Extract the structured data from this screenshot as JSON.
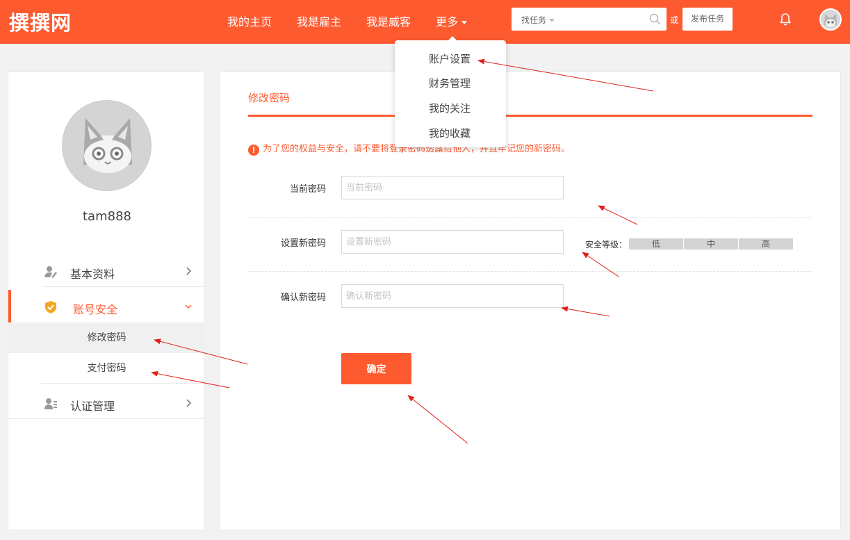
{
  "header": {
    "logo": "撰撰网",
    "nav": [
      "我的主页",
      "我是雇主",
      "我是威客"
    ],
    "more_label": "更多",
    "search": {
      "type_label": "找任务"
    },
    "or_text": "或",
    "publish_label": "发布任务"
  },
  "dropdown": {
    "items": [
      "账户设置",
      "财务管理",
      "我的关注",
      "我的收藏"
    ]
  },
  "sidebar": {
    "username": "tam888",
    "menu": {
      "basic": "基本资料",
      "security": "账号安全",
      "auth": "认证管理"
    },
    "submenu": {
      "change_password": "修改密码",
      "pay_password": "支付密码"
    }
  },
  "main": {
    "tab_title": "修改密码",
    "warning": "为了您的权益与安全，请不要将登录密码透露给他人，并且牢记您的新密码。",
    "fields": {
      "current_label": "当前密码",
      "current_placeholder": "当前密码",
      "new_label": "设置新密码",
      "new_placeholder": "设置新密码",
      "confirm_label": "确认新密码",
      "confirm_placeholder": "确认新密码"
    },
    "strength": {
      "label": "安全等级：",
      "levels": [
        "低",
        "中",
        "高"
      ]
    },
    "submit_label": "确定"
  },
  "colors": {
    "brand": "#fe5a30",
    "arrow": "#e0201a"
  }
}
